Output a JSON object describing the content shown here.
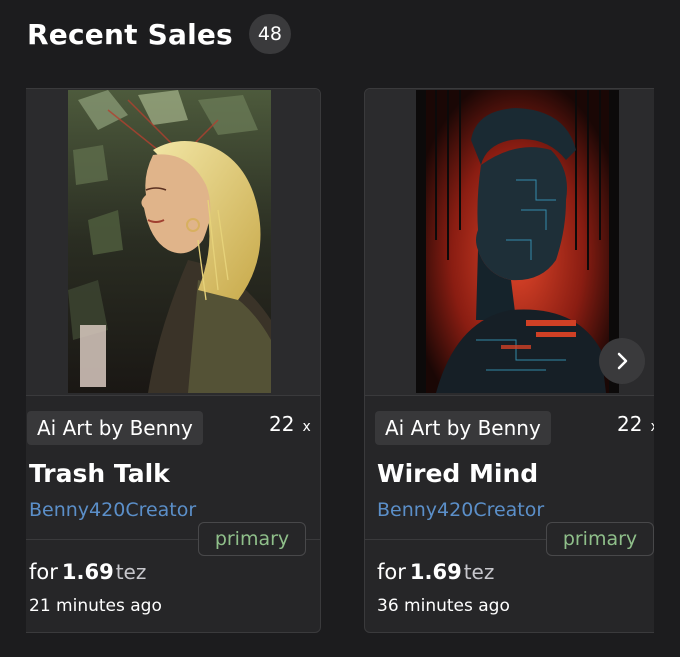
{
  "header": {
    "title": "Recent Sales",
    "count": "48"
  },
  "cards": [
    {
      "collection": "Ai Art by Benny",
      "edition": "22",
      "edition_suffix": "x",
      "name": "Trash Talk",
      "creator": "Benny420Creator",
      "sale_type": "primary",
      "price_prefix": "for",
      "price": "1.69",
      "currency": "tez",
      "time": "21 minutes ago"
    },
    {
      "collection": "Ai Art by Benny",
      "edition": "22",
      "edition_suffix": "x",
      "name": "Wired Mind",
      "creator": "Benny420Creator",
      "sale_type": "primary",
      "price_prefix": "for",
      "price": "1.69",
      "currency": "tez",
      "time": "36 minutes ago"
    }
  ],
  "icons": {
    "next": "chevron-right-icon"
  },
  "colors": {
    "background": "#1c1c1e",
    "card": "#262628",
    "creator_link": "#5b8fc9",
    "sale_type": "#8fbf8a"
  }
}
